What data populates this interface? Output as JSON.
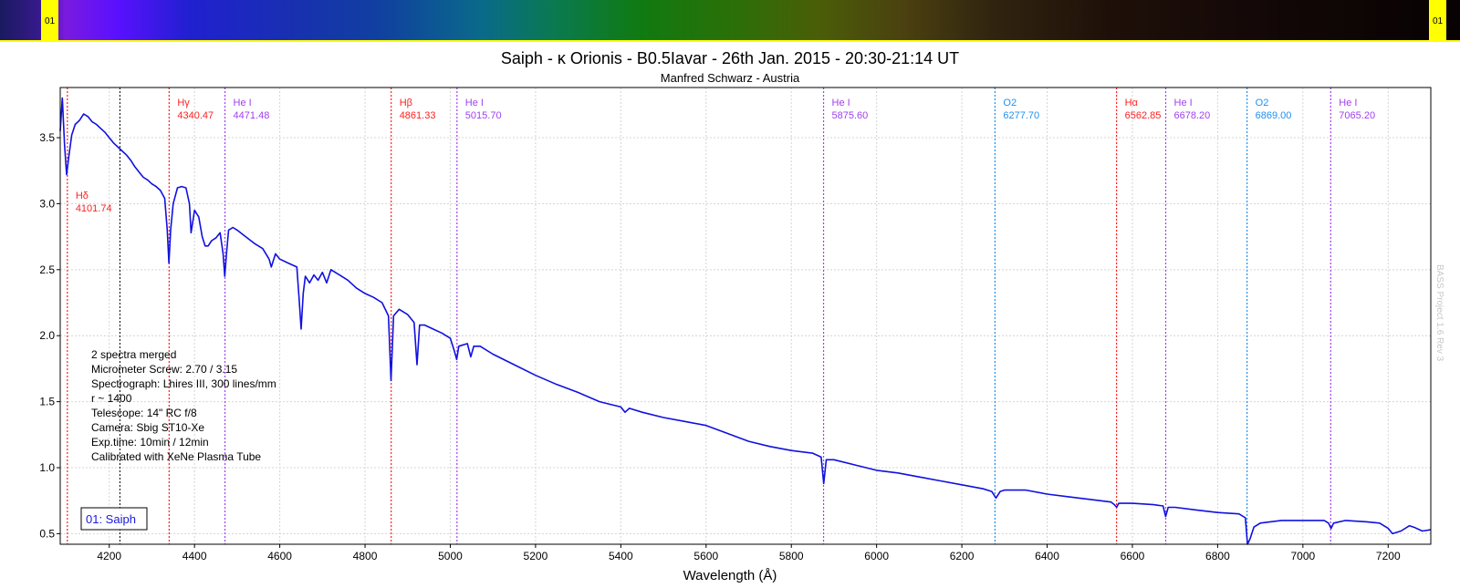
{
  "chart_data": {
    "type": "line",
    "title": "Saiph - κ Orionis - B0.5Iavar - 26th Jan. 2015 - 20:30-21:14 UT",
    "subtitle": "Manfred Schwarz - Austria",
    "xlabel": "Wavelength (Å)",
    "ylabel": "",
    "xlim": [
      4085,
      7300
    ],
    "ylim": [
      0.42,
      3.88
    ],
    "x_ticks": [
      4200,
      4400,
      4600,
      4800,
      5000,
      5200,
      5400,
      5600,
      5800,
      6000,
      6200,
      6400,
      6600,
      6800,
      7000,
      7200
    ],
    "x_tick_labels": [
      "4200",
      "4400",
      "4600",
      "4800",
      "5000",
      "5200",
      "5400",
      "5600",
      "5800",
      "6000",
      "6200",
      "6400",
      "6600",
      "6800",
      "7000",
      "7200"
    ],
    "y_ticks": [
      0.5,
      1.0,
      1.5,
      2.0,
      2.5,
      3.0,
      3.5
    ],
    "y_tick_labels": [
      "0.5",
      "1.0",
      "1.5",
      "2.0",
      "2.5",
      "3.0",
      "3.5"
    ],
    "grid": true,
    "cursor_line_x": 4225,
    "series": [
      {
        "name": "01: Saiph",
        "color": "#1010e0",
        "points": [
          [
            4085,
            3.55
          ],
          [
            4090,
            3.8
          ],
          [
            4095,
            3.45
          ],
          [
            4100,
            3.22
          ],
          [
            4105,
            3.35
          ],
          [
            4112,
            3.52
          ],
          [
            4120,
            3.6
          ],
          [
            4130,
            3.63
          ],
          [
            4140,
            3.68
          ],
          [
            4150,
            3.66
          ],
          [
            4160,
            3.62
          ],
          [
            4170,
            3.6
          ],
          [
            4180,
            3.57
          ],
          [
            4190,
            3.54
          ],
          [
            4200,
            3.5
          ],
          [
            4210,
            3.46
          ],
          [
            4220,
            3.43
          ],
          [
            4230,
            3.4
          ],
          [
            4240,
            3.37
          ],
          [
            4250,
            3.33
          ],
          [
            4260,
            3.28
          ],
          [
            4270,
            3.24
          ],
          [
            4280,
            3.2
          ],
          [
            4290,
            3.18
          ],
          [
            4300,
            3.15
          ],
          [
            4310,
            3.13
          ],
          [
            4320,
            3.1
          ],
          [
            4330,
            3.04
          ],
          [
            4336,
            2.8
          ],
          [
            4340,
            2.55
          ],
          [
            4344,
            2.8
          ],
          [
            4350,
            3.0
          ],
          [
            4360,
            3.12
          ],
          [
            4370,
            3.13
          ],
          [
            4380,
            3.12
          ],
          [
            4388,
            3.0
          ],
          [
            4392,
            2.78
          ],
          [
            4400,
            2.95
          ],
          [
            4410,
            2.9
          ],
          [
            4418,
            2.75
          ],
          [
            4425,
            2.68
          ],
          [
            4432,
            2.68
          ],
          [
            4440,
            2.72
          ],
          [
            4450,
            2.74
          ],
          [
            4460,
            2.78
          ],
          [
            4467,
            2.62
          ],
          [
            4471,
            2.45
          ],
          [
            4475,
            2.62
          ],
          [
            4480,
            2.8
          ],
          [
            4490,
            2.82
          ],
          [
            4500,
            2.8
          ],
          [
            4520,
            2.75
          ],
          [
            4540,
            2.7
          ],
          [
            4560,
            2.66
          ],
          [
            4575,
            2.58
          ],
          [
            4580,
            2.52
          ],
          [
            4590,
            2.62
          ],
          [
            4600,
            2.58
          ],
          [
            4620,
            2.55
          ],
          [
            4640,
            2.52
          ],
          [
            4645,
            2.3
          ],
          [
            4650,
            2.05
          ],
          [
            4655,
            2.32
          ],
          [
            4660,
            2.45
          ],
          [
            4670,
            2.4
          ],
          [
            4680,
            2.46
          ],
          [
            4690,
            2.42
          ],
          [
            4700,
            2.48
          ],
          [
            4710,
            2.4
          ],
          [
            4720,
            2.5
          ],
          [
            4730,
            2.48
          ],
          [
            4740,
            2.46
          ],
          [
            4760,
            2.42
          ],
          [
            4780,
            2.36
          ],
          [
            4800,
            2.32
          ],
          [
            4820,
            2.29
          ],
          [
            4840,
            2.25
          ],
          [
            4855,
            2.15
          ],
          [
            4861,
            1.66
          ],
          [
            4867,
            2.15
          ],
          [
            4880,
            2.2
          ],
          [
            4900,
            2.16
          ],
          [
            4915,
            2.1
          ],
          [
            4922,
            1.78
          ],
          [
            4928,
            2.08
          ],
          [
            4940,
            2.08
          ],
          [
            4960,
            2.05
          ],
          [
            4980,
            2.02
          ],
          [
            5000,
            1.98
          ],
          [
            5010,
            1.88
          ],
          [
            5015,
            1.82
          ],
          [
            5020,
            1.92
          ],
          [
            5040,
            1.94
          ],
          [
            5048,
            1.84
          ],
          [
            5055,
            1.92
          ],
          [
            5070,
            1.92
          ],
          [
            5100,
            1.86
          ],
          [
            5150,
            1.78
          ],
          [
            5200,
            1.7
          ],
          [
            5250,
            1.63
          ],
          [
            5300,
            1.57
          ],
          [
            5350,
            1.5
          ],
          [
            5400,
            1.46
          ],
          [
            5410,
            1.42
          ],
          [
            5420,
            1.45
          ],
          [
            5450,
            1.42
          ],
          [
            5500,
            1.38
          ],
          [
            5550,
            1.35
          ],
          [
            5600,
            1.32
          ],
          [
            5650,
            1.26
          ],
          [
            5700,
            1.2
          ],
          [
            5750,
            1.16
          ],
          [
            5800,
            1.13
          ],
          [
            5850,
            1.11
          ],
          [
            5870,
            1.08
          ],
          [
            5876,
            0.88
          ],
          [
            5882,
            1.06
          ],
          [
            5900,
            1.06
          ],
          [
            5950,
            1.02
          ],
          [
            6000,
            0.98
          ],
          [
            6050,
            0.96
          ],
          [
            6100,
            0.93
          ],
          [
            6150,
            0.9
          ],
          [
            6200,
            0.87
          ],
          [
            6250,
            0.84
          ],
          [
            6270,
            0.82
          ],
          [
            6280,
            0.77
          ],
          [
            6290,
            0.82
          ],
          [
            6300,
            0.83
          ],
          [
            6350,
            0.83
          ],
          [
            6400,
            0.8
          ],
          [
            6450,
            0.78
          ],
          [
            6500,
            0.76
          ],
          [
            6550,
            0.74
          ],
          [
            6558,
            0.72
          ],
          [
            6563,
            0.7
          ],
          [
            6568,
            0.73
          ],
          [
            6600,
            0.73
          ],
          [
            6650,
            0.72
          ],
          [
            6672,
            0.71
          ],
          [
            6678,
            0.63
          ],
          [
            6684,
            0.7
          ],
          [
            6700,
            0.7
          ],
          [
            6750,
            0.68
          ],
          [
            6800,
            0.66
          ],
          [
            6850,
            0.65
          ],
          [
            6865,
            0.62
          ],
          [
            6870,
            0.42
          ],
          [
            6876,
            0.46
          ],
          [
            6885,
            0.55
          ],
          [
            6900,
            0.58
          ],
          [
            6950,
            0.6
          ],
          [
            7000,
            0.6
          ],
          [
            7050,
            0.6
          ],
          [
            7060,
            0.58
          ],
          [
            7066,
            0.54
          ],
          [
            7072,
            0.58
          ],
          [
            7100,
            0.6
          ],
          [
            7150,
            0.59
          ],
          [
            7180,
            0.58
          ],
          [
            7200,
            0.54
          ],
          [
            7210,
            0.5
          ],
          [
            7230,
            0.52
          ],
          [
            7250,
            0.56
          ],
          [
            7260,
            0.55
          ],
          [
            7280,
            0.52
          ],
          [
            7300,
            0.53
          ]
        ]
      }
    ],
    "reference_lines": [
      {
        "label": "Hδ",
        "value": "4101.74",
        "x": 4101.74,
        "color": "#ff2020"
      },
      {
        "label": "Hγ",
        "value": "4340.47",
        "x": 4340.47,
        "color": "#ff2020"
      },
      {
        "label": "He I",
        "value": "4471.48",
        "x": 4471.48,
        "color": "#a040f0"
      },
      {
        "label": "Hβ",
        "value": "4861.33",
        "x": 4861.33,
        "color": "#ff2020"
      },
      {
        "label": "He I",
        "value": "5015.70",
        "x": 5015.7,
        "color": "#a040f0"
      },
      {
        "label": "He I",
        "value": "5875.60",
        "x": 5875.6,
        "color": "#a040f0"
      },
      {
        "label": "O2",
        "value": "6277.70",
        "x": 6277.7,
        "color": "#2090f0"
      },
      {
        "label": "Hα",
        "value": "6562.85",
        "x": 6562.85,
        "color": "#ff2020"
      },
      {
        "label": "He I",
        "value": "6678.20",
        "x": 6678.2,
        "color": "#a040f0"
      },
      {
        "label": "O2",
        "value": "6869.00",
        "x": 6869.0,
        "color": "#2090f0"
      },
      {
        "label": "He I",
        "value": "7065.20",
        "x": 7065.2,
        "color": "#a040f0"
      }
    ],
    "notes": [
      "2 spectra merged",
      "Micrometer Screw: 2.70 / 3.15",
      "Spectrograph: Lhires III, 300 lines/mm",
      "r ~ 1400",
      "Telescope: 14\" RC f/8",
      "Camera: Sbig ST10-Xe",
      "Exp.time: 10min / 12min",
      "Calibrated with XeNe Plasma Tube"
    ],
    "legend": {
      "label": "01: Saiph",
      "placement": "bottom-left"
    },
    "watermark": "BASS Project 1.6 Rev 3"
  },
  "spectrum_band": {
    "left_badge": "01",
    "right_badge": "01",
    "badge_color": "#ffff00",
    "border_color": "#ffff00"
  }
}
